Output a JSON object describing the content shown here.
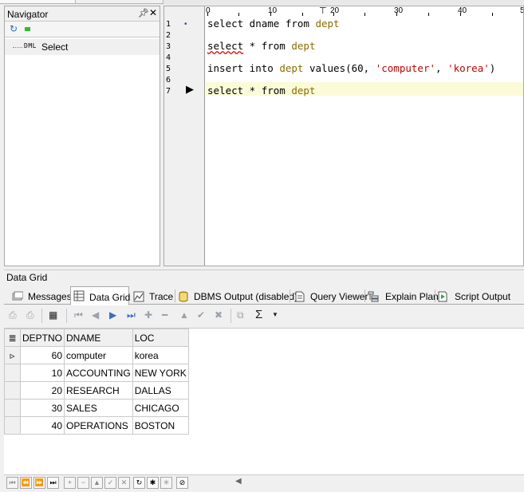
{
  "navigator": {
    "title": "Navigator",
    "tree_item_tag": "DML",
    "tree_item_label": "Select"
  },
  "editor": {
    "ruler": [
      "0",
      "10",
      "20",
      "30",
      "40",
      "5"
    ],
    "line_numbers": [
      "1",
      "2",
      "3",
      "4",
      "5",
      "6",
      "7"
    ],
    "lines": {
      "l1_kw": "select dname from ",
      "l1_tbl": "dept",
      "l3_kw": "select",
      "l3_rest": " * from ",
      "l3_tbl": "dept",
      "l5_kw": "insert into ",
      "l5_tbl": "dept",
      "l5_mid": " values(60, ",
      "l5_s1": "'computer'",
      "l5_comma": ", ",
      "l5_s2": "'korea'",
      "l5_end": ")",
      "l7_kw": "select * from ",
      "l7_tbl": "dept"
    }
  },
  "data_grid": {
    "panel_title": "Data Grid",
    "tabs": [
      "Messages",
      "Data Grid",
      "Trace",
      "DBMS Output (disabled)",
      "Query Viewer",
      "Explain Plan",
      "Script Output"
    ],
    "columns": [
      "DEPTNO",
      "DNAME",
      "LOC"
    ],
    "rows": [
      [
        "60",
        "computer",
        "korea"
      ],
      [
        "10",
        "ACCOUNTING",
        "NEW YORK"
      ],
      [
        "20",
        "RESEARCH",
        "DALLAS"
      ],
      [
        "30",
        "SALES",
        "CHICAGO"
      ],
      [
        "40",
        "OPERATIONS",
        "BOSTON"
      ]
    ],
    "sigma": "Σ"
  },
  "colors": {
    "table_keyword": "#8a6c00",
    "string_literal": "#c00000",
    "current_line_highlight": "#fbfbd7"
  }
}
